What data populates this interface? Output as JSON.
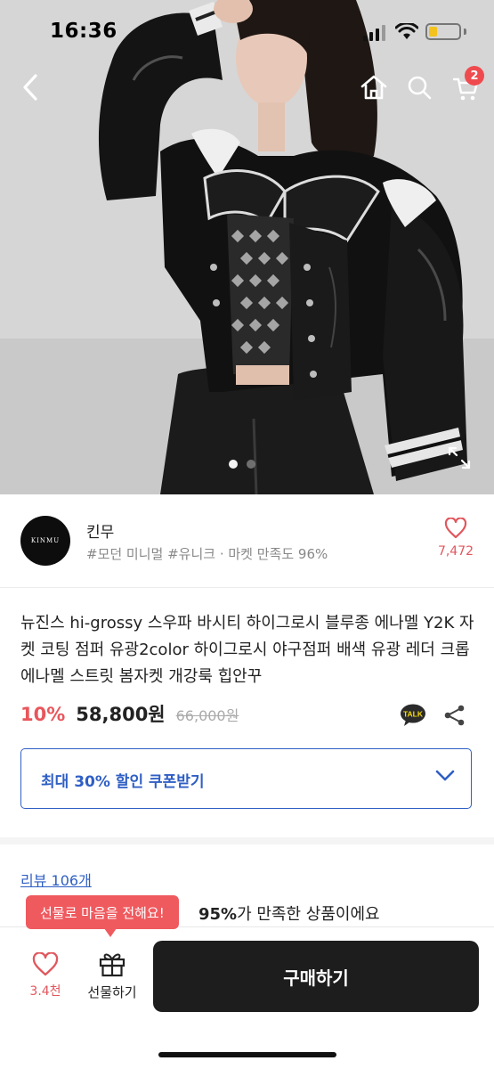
{
  "status_bar": {
    "time": "16:36"
  },
  "colors": {
    "accent_red": "#e8565b",
    "accent_blue": "#2f5fc4",
    "badge_red": "#ef4b4f",
    "battery_yellow": "#f3c21c",
    "tooltip_bg": "#ef5a5f"
  },
  "header": {
    "cart_count": "2"
  },
  "gallery": {
    "current_page": 1,
    "total_pages": 2
  },
  "shop": {
    "logo_text": "KINMU",
    "name": "킨무",
    "tags_line": "#모던 미니멀 #유니크 · 마켓 만족도 96%",
    "favorite_count": "7,472"
  },
  "product": {
    "title": "뉴진스 hi-grossy 스우파 바시티 하이그로시 블루종 에나멜 Y2K 자켓 코팅 점퍼 유광2color 하이그로시 야구점퍼 배색 유광 레더 크롭 에나멜 스트릿 봄자켓 개강룩 힙안꾸",
    "discount": "10%",
    "price": "58,800원",
    "original_price": "66,000원",
    "talk_label": "TALK"
  },
  "coupon": {
    "label": "최대 30% 할인 쿠폰받기"
  },
  "reviews": {
    "link_label": "리뷰 106개",
    "satisfaction_pct": "95%",
    "satisfaction_suffix": "가 만족한 상품이에요"
  },
  "tooltip": {
    "text": "선물로 마음을 전해요!"
  },
  "bottom_bar": {
    "like_count": "3.4천",
    "gift_label": "선물하기",
    "buy_label": "구매하기"
  },
  "icons": [
    "back-arrow-icon",
    "home-icon",
    "search-icon",
    "cart-icon",
    "expand-icon",
    "kakao-talk-icon",
    "share-icon",
    "chevron-down-icon",
    "heart-icon",
    "gift-icon"
  ]
}
